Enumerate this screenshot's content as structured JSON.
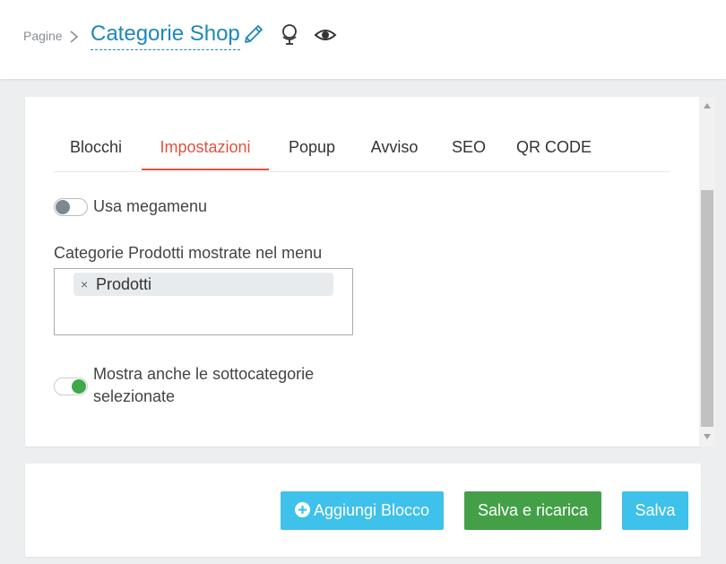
{
  "header": {
    "breadcrumb_parent": "Pagine",
    "title": "Categorie Shop",
    "icons": [
      "chevron-right-icon",
      "pencil-icon",
      "globe-icon",
      "eye-icon"
    ]
  },
  "tabs": [
    {
      "label": "Blocchi",
      "active": false
    },
    {
      "label": "Impostazioni",
      "active": true
    },
    {
      "label": "Popup",
      "active": false
    },
    {
      "label": "Avviso",
      "active": false
    },
    {
      "label": "SEO",
      "active": false
    },
    {
      "label": "QR CODE",
      "active": false
    }
  ],
  "settings": {
    "megamenu": {
      "label": "Usa megamenu",
      "enabled": false
    },
    "categories_label": "Categorie Prodotti mostrate nel menu",
    "selected_categories": [
      {
        "label": "Prodotti",
        "remove_symbol": "×"
      }
    ],
    "show_subcategories": {
      "label_line1": "Mostra anche le sottocategorie",
      "label_line2": "selezionate",
      "enabled": true
    }
  },
  "actions": {
    "add_block": "Aggiungi Blocco",
    "save_reload": "Salva e ricarica",
    "save": "Salva"
  },
  "colors": {
    "accent_blue": "#1e88b8",
    "active_tab": "#e0523f",
    "button_blue": "#3ec1ea",
    "button_green": "#43a047",
    "toggle_on": "#3ea84a"
  }
}
